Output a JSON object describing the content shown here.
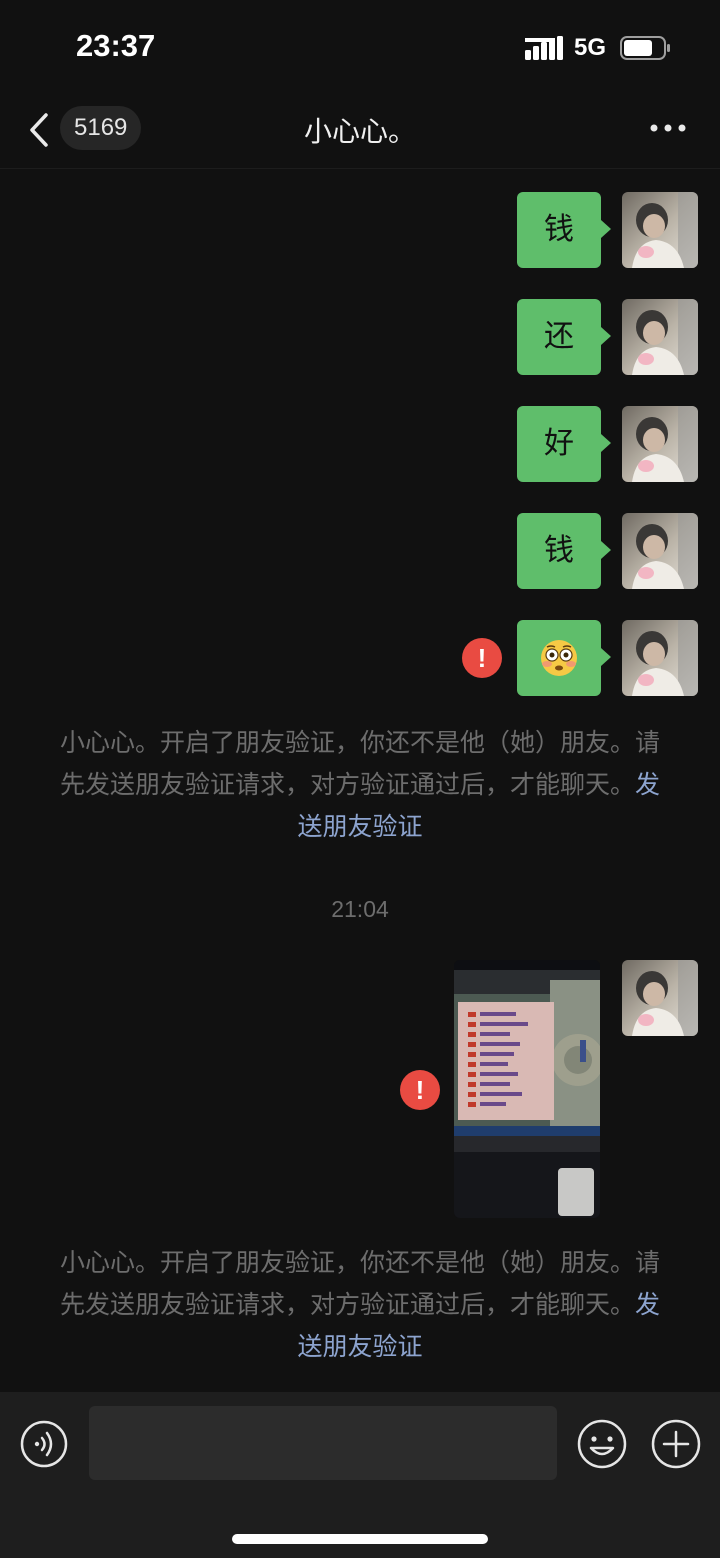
{
  "status_bar": {
    "time": "23:37",
    "network": "5G",
    "signal_icon": "signal-bars-icon",
    "battery_icon": "battery-icon"
  },
  "nav": {
    "back_icon": "chevron-left-icon",
    "unread_count": "5169",
    "title": "小心心。",
    "more_icon": "more-dots-icon"
  },
  "messages": [
    {
      "type": "text",
      "direction": "outgoing",
      "text": "钱",
      "failed": false
    },
    {
      "type": "text",
      "direction": "outgoing",
      "text": "还",
      "failed": false
    },
    {
      "type": "text",
      "direction": "outgoing",
      "text": "好",
      "failed": false
    },
    {
      "type": "text",
      "direction": "outgoing",
      "text": "钱",
      "failed": false
    },
    {
      "type": "emoji",
      "direction": "outgoing",
      "text": "😳",
      "failed": true
    }
  ],
  "system_notices": [
    {
      "text": "小心心。开启了朋友验证，你还不是他（她）朋友。请先发送朋友验证请求，对方验证通过后，才能聊天。",
      "link": "发送朋友验证"
    },
    {
      "text": "小心心。开启了朋友验证，你还不是他（她）朋友。请先发送朋友验证请求，对方验证通过后，才能聊天。",
      "link": "发送朋友验证"
    }
  ],
  "timestamp": "21:04",
  "image_message": {
    "direction": "outgoing",
    "failed": true,
    "subject": "photo of a game screen"
  },
  "error_badge_symbol": "!",
  "input_bar": {
    "voice_icon": "voice-icon",
    "emoji_icon": "emoji-icon",
    "plus_icon": "plus-icon",
    "input_value": ""
  },
  "colors": {
    "background": "#111111",
    "bubble_green": "#5fbe6b",
    "error_red": "#e94b42",
    "link_blue": "#8da4cf",
    "notice_gray": "#6d6d6d"
  }
}
